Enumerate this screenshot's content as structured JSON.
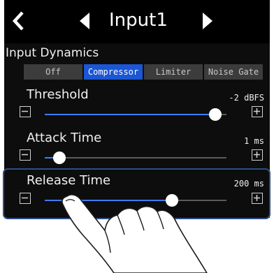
{
  "header": {
    "title": "Input1"
  },
  "section": {
    "label": "Input Dynamics"
  },
  "modes": [
    {
      "label": "Off",
      "active": false
    },
    {
      "label": "Compressor",
      "active": true
    },
    {
      "label": "Limiter",
      "active": false
    },
    {
      "label": "Noise Gate",
      "active": false
    }
  ],
  "params": {
    "threshold": {
      "label": "Threshold",
      "value": "-2 dBFS",
      "level": 0.94
    },
    "attack": {
      "label": "Attack Time",
      "value": "1 ms",
      "level": 0.08
    },
    "release": {
      "label": "Release Time",
      "value": "200 ms",
      "level": 0.7
    }
  },
  "colors": {
    "accent": "#1b56d4",
    "highlight": "#2f4f86"
  },
  "icons": [
    "back-icon",
    "previous-input-icon",
    "next-input-icon",
    "minus-icon",
    "plus-icon",
    "pointing-hand-icon"
  ]
}
